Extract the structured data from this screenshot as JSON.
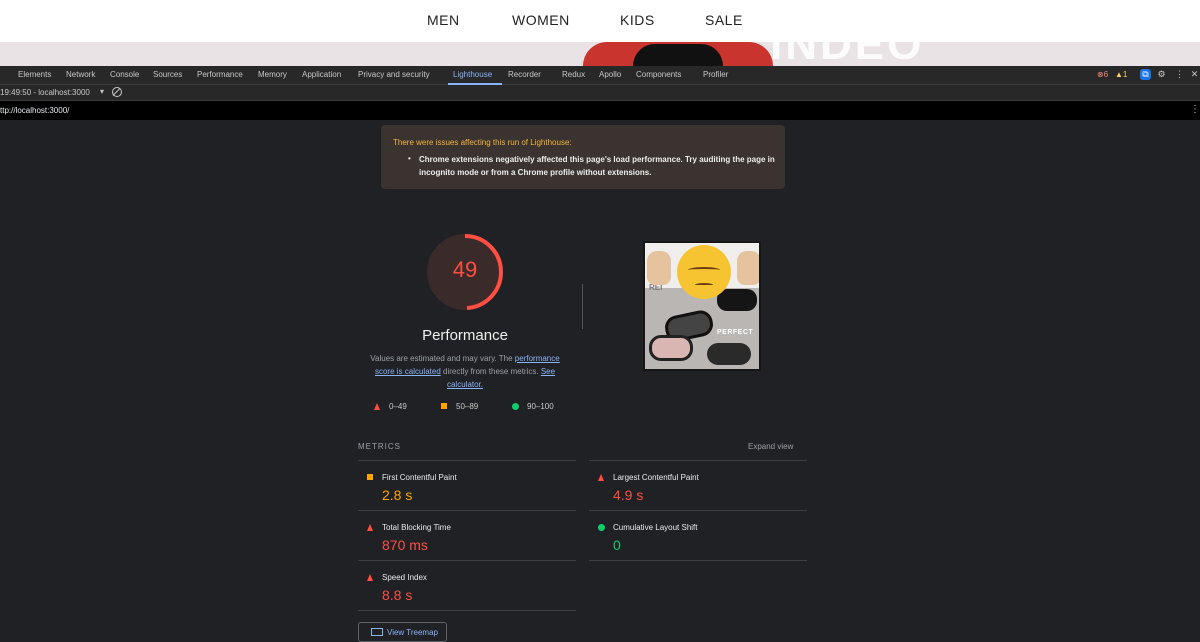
{
  "site_nav": {
    "links": [
      "MEN",
      "WOMEN",
      "KIDS",
      "SALE"
    ],
    "hero_text": "INDEO"
  },
  "devtools": {
    "tabs": [
      "Elements",
      "Network",
      "Console",
      "Sources",
      "Performance",
      "Memory",
      "Application",
      "Privacy and security",
      "Lighthouse",
      "Recorder",
      "Redux",
      "Apollo",
      "Components",
      "Profiler"
    ],
    "active_tab": "Lighthouse",
    "error_count": "6",
    "warning_count": "1",
    "run_label": "19:49:50 - localhost:3000",
    "url": "ttp://localhost:3000/"
  },
  "warning": {
    "title": "There were issues affecting this run of Lighthouse:",
    "item": "Chrome extensions negatively affected this page's load performance. Try auditing the page in incognito mode or from a Chrome profile without extensions."
  },
  "score": {
    "value": 49,
    "display": "49",
    "title": "Performance",
    "desc_1": "Values are estimated and may vary. The",
    "link_1": "performance score is calculated",
    "desc_2": "directly from these metrics.",
    "link_2": "See calculator.",
    "color": "#ff4e42"
  },
  "legend": [
    {
      "shape": "triangle",
      "label": "0–49"
    },
    {
      "shape": "square",
      "label": "50–89"
    },
    {
      "shape": "circle",
      "label": "90–100"
    }
  ],
  "thumbnail": {
    "brand_text": "PERFECT",
    "ref_text": "REI"
  },
  "metrics": {
    "header": "METRICS",
    "expand_label": "Expand view",
    "items": [
      {
        "name": "First Contentful Paint",
        "value": "2.8 s",
        "rating": "average",
        "color": "#ffa400"
      },
      {
        "name": "Largest Contentful Paint",
        "value": "4.9 s",
        "rating": "fail",
        "color": "#ff4e42"
      },
      {
        "name": "Total Blocking Time",
        "value": "870 ms",
        "rating": "fail",
        "color": "#ff4e42"
      },
      {
        "name": "Cumulative Layout Shift",
        "value": "0",
        "rating": "pass",
        "color": "#0cce6b"
      },
      {
        "name": "Speed Index",
        "value": "8.8 s",
        "rating": "fail",
        "color": "#ff4e42"
      }
    ],
    "treemap_label": "View Treemap"
  }
}
